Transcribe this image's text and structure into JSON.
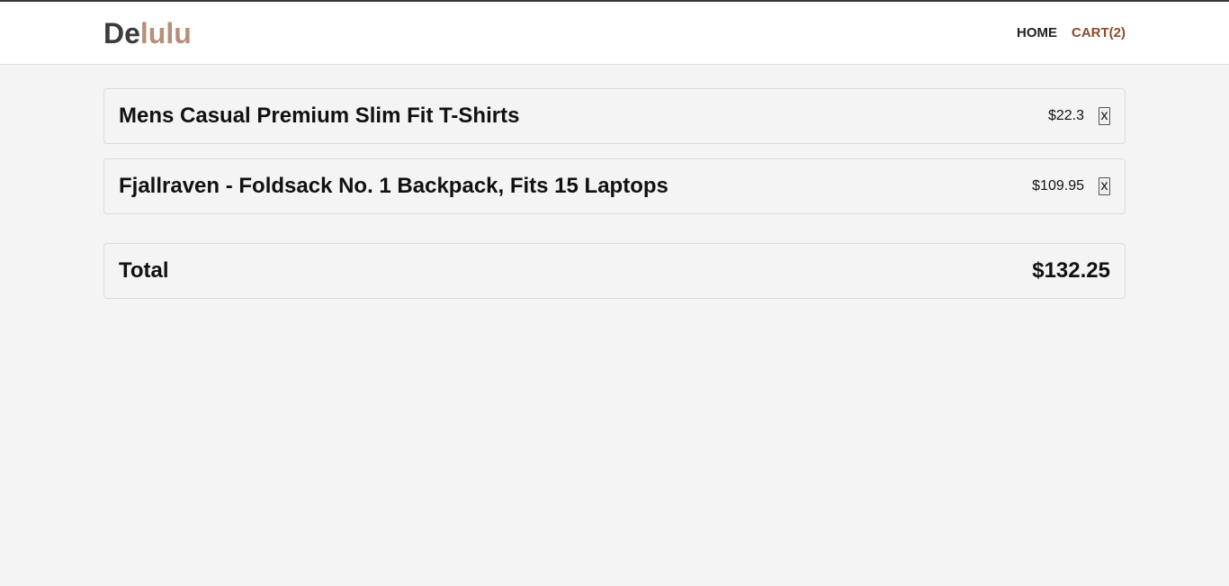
{
  "header": {
    "logo_part1": "De",
    "logo_part2": "lulu",
    "nav": {
      "home": "HOME",
      "cart": "CART(2)"
    }
  },
  "cart": {
    "items": [
      {
        "title": "Mens Casual Premium Slim Fit T-Shirts",
        "price": "$22.3",
        "remove_label": "x"
      },
      {
        "title": "Fjallraven - Foldsack No. 1 Backpack, Fits 15 Laptops",
        "price": "$109.95",
        "remove_label": "x"
      }
    ],
    "total_label": "Total",
    "total_value": "$132.25"
  },
  "colors": {
    "logo_dark": "#3b3b3b",
    "logo_accent": "#b98e78",
    "cart_link": "#8f4a2b",
    "background": "#f4f4f4"
  }
}
